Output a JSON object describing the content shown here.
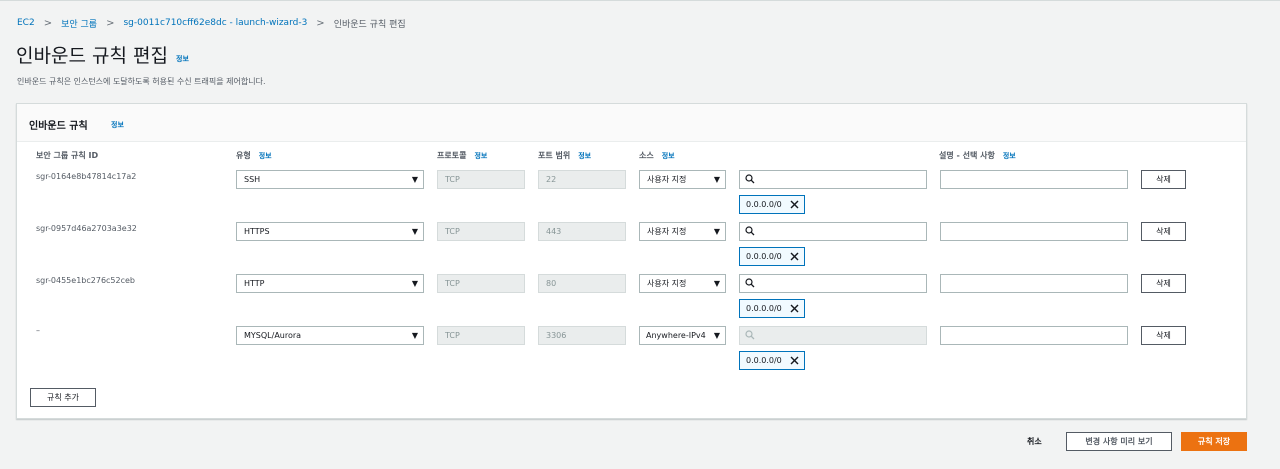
{
  "breadcrumb": {
    "items": [
      "EC2",
      "보안 그룹",
      "sg-0011c710cff62e8dc - launch-wizard-3"
    ],
    "current": "인바운드 규칙 편집",
    "separator": ">"
  },
  "page": {
    "title": "인바운드 규칙 편집",
    "info": "정보",
    "description": "인바운드 규칙은 인스턴스에 도달하도록 허용된 수신 트래픽을 제어합니다."
  },
  "panel": {
    "title": "인바운드 규칙",
    "info": "정보"
  },
  "columns": {
    "rule_id": "보안 그룹 규칙 ID",
    "type": "유형",
    "protocol": "프로토콜",
    "port_range": "포트 범위",
    "source": "소스",
    "description": "설명 - 선택 사항",
    "info": "정보"
  },
  "rules": [
    {
      "id": "sgr-0164e8b47814c17a2",
      "type": "SSH",
      "protocol": "TCP",
      "port": "22",
      "source": "사용자 지정",
      "cidr": "0.0.0.0/0",
      "delete": "삭제"
    },
    {
      "id": "sgr-0957d46a2703a3e32",
      "type": "HTTPS",
      "protocol": "TCP",
      "port": "443",
      "source": "사용자 지정",
      "cidr": "0.0.0.0/0",
      "delete": "삭제"
    },
    {
      "id": "sgr-0455e1bc276c52ceb",
      "type": "HTTP",
      "protocol": "TCP",
      "port": "80",
      "source": "사용자 지정",
      "cidr": "0.0.0.0/0",
      "delete": "삭제"
    },
    {
      "id": "–",
      "type": "MYSQL/Aurora",
      "protocol": "TCP",
      "port": "3306",
      "source": "Anywhere-IPv4",
      "cidr": "0.0.0.0/0",
      "delete": "삭제"
    }
  ],
  "add_rule": "규칙 추가",
  "footer": {
    "cancel": "취소",
    "preview": "변경 사항 미리 보기",
    "save": "규칙 저장"
  },
  "colors": {
    "link": "#0073bb",
    "primary": "#ec7211",
    "background": "#f2f3f3"
  }
}
